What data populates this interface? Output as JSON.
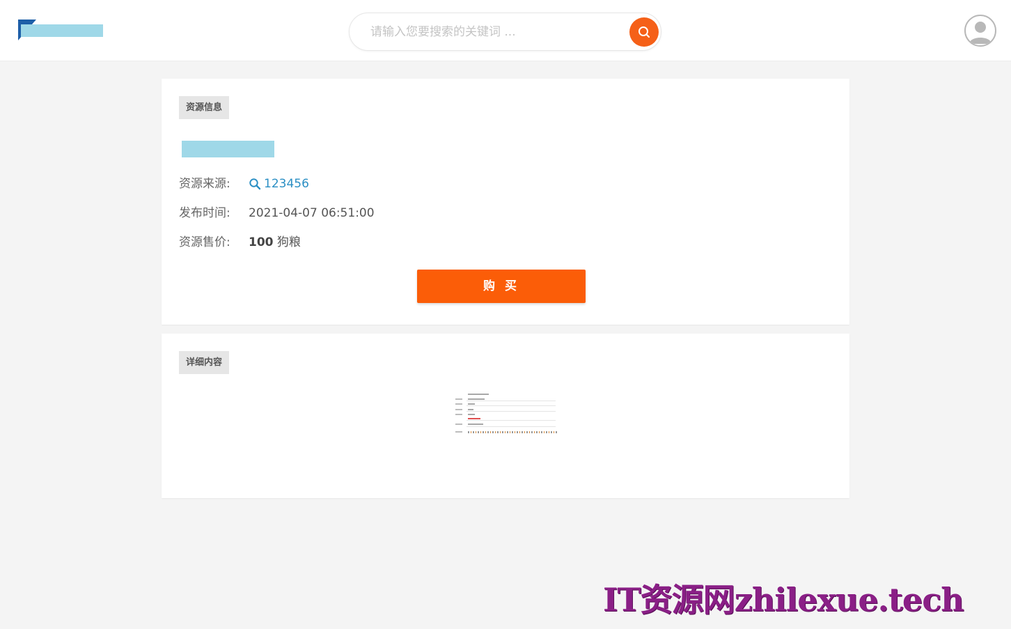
{
  "header": {
    "search": {
      "placeholder": "请输入您要搜索的关键词 ..."
    },
    "icons": {
      "search": "search-icon",
      "avatar": "user-avatar-icon"
    }
  },
  "resource_info": {
    "tag": "资源信息",
    "source_label": "资源来源:",
    "source_value": "123456",
    "time_label": "发布时间:",
    "time_value": "2021-04-07 06:51:00",
    "price_label": "资源售价:",
    "price_value": "100",
    "price_unit": "狗粮",
    "buy_label": "购 买"
  },
  "detail": {
    "tag": "详细内容"
  },
  "watermark": "IT资源网zhilexue.tech",
  "colors": {
    "accent": "#fb5d08",
    "search_button": "#f56018",
    "link": "#2b8fc4",
    "background": "#f4f4f4",
    "watermark": "#8a1f86"
  }
}
